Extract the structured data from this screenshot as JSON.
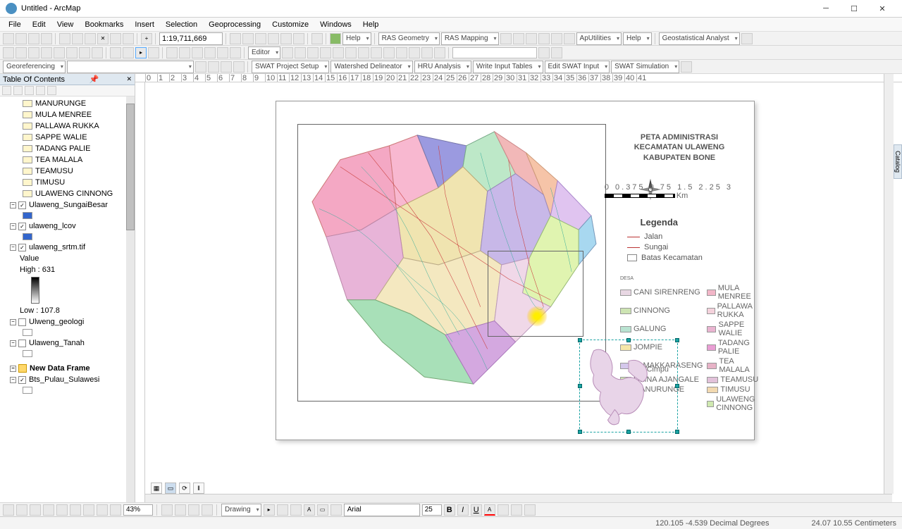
{
  "window": {
    "title": "Untitled - ArcMap"
  },
  "menu": [
    "File",
    "Edit",
    "View",
    "Bookmarks",
    "Insert",
    "Selection",
    "Geoprocessing",
    "Customize",
    "Windows",
    "Help"
  ],
  "toolbar1": {
    "scale": "1:19,711,669",
    "help": "Help",
    "ras_geom": "RAS Geometry",
    "ras_mapping": "RAS Mapping",
    "aputil": "ApUtilities",
    "help2": "Help",
    "geostat": "Geostatistical Analyst"
  },
  "toolbar2": {
    "editor": "Editor",
    "swat_setup": "SWAT Project Setup",
    "wshed": "Watershed Delineator",
    "hru": "HRU Analysis",
    "write_in": "Write Input Tables",
    "edit_swat": "Edit SWAT Input",
    "swat_sim": "SWAT Simulation",
    "georef": "Georeferencing"
  },
  "toc": {
    "title": "Table Of Contents",
    "layers": [
      {
        "label": "MANURUNGE",
        "type": "sym"
      },
      {
        "label": "MULA MENREE",
        "type": "sym"
      },
      {
        "label": "PALLAWA RUKKA",
        "type": "sym"
      },
      {
        "label": "SAPPE WALIE",
        "type": "sym"
      },
      {
        "label": "TADANG PALIE",
        "type": "sym"
      },
      {
        "label": "TEA MALALA",
        "type": "sym"
      },
      {
        "label": "TEAMUSU",
        "type": "sym"
      },
      {
        "label": "TIMUSU",
        "type": "sym"
      },
      {
        "label": "ULAWENG CINNONG",
        "type": "sym"
      }
    ],
    "groups": [
      {
        "label": "Ulaweng_SungaiBesar",
        "checked": true
      },
      {
        "label": "ulaweng_lcov",
        "checked": true
      },
      {
        "label": "ulaweng_srtm.tif",
        "checked": true,
        "value_label": "Value",
        "high": "High : 631",
        "low": "Low : 107.8",
        "gradient": true
      },
      {
        "label": "Ulweng_geologi",
        "checked": false
      },
      {
        "label": "Ulaweng_Tanah",
        "checked": false
      }
    ],
    "newframe": "New Data Frame",
    "inset_layer": "Bts_Pulau_Sulawesi"
  },
  "layout": {
    "title_l1": "PETA ADMINISTRASI",
    "title_l2": "KECAMATAN ULAWENG",
    "title_l3": "KABUPATEN BONE",
    "scale_ticks": "0 0.375 0.75  1.5  2.25  3",
    "scale_unit": "Km",
    "legend_title": "Legenda",
    "legend_lines": [
      {
        "label": "Jalan"
      },
      {
        "label": "Sungai"
      },
      {
        "label": "Batas Kecamatan",
        "box": true
      }
    ],
    "desa_hdr": "DESA",
    "desa": [
      {
        "c": "#e8d7e3",
        "l": "CANI SIRENRENG"
      },
      {
        "c": "#f2b6c8",
        "l": "MULA MENREE"
      },
      {
        "c": "#cde4b3",
        "l": "CINNONG"
      },
      {
        "c": "#f4d2dc",
        "l": "PALLAWA RUKKA"
      },
      {
        "c": "#b9e3d1",
        "l": "GALUNG"
      },
      {
        "c": "#eab4d1",
        "l": "SAPPE WALIE"
      },
      {
        "c": "#f5e6a8",
        "l": "JOMPIE"
      },
      {
        "c": "#e99ed4",
        "l": "TADANG PALIE"
      },
      {
        "c": "#d4c7ec",
        "l": "LAMAKKARASENG"
      },
      {
        "c": "#e7b3c7",
        "l": "TEA MALALA"
      },
      {
        "c": "#d1e8b3",
        "l": "LILINA AJANGALE"
      },
      {
        "c": "#e2c2da",
        "l": "TEAMUSU"
      },
      {
        "c": "#f4efb3",
        "l": "MANURUNGE"
      },
      {
        "c": "#f2d9b0",
        "l": "TIMUSU"
      },
      {
        "c": "",
        "l": ""
      },
      {
        "c": "#cfe9b0",
        "l": "ULAWENG CINNONG"
      }
    ]
  },
  "ruler_ticks": [
    "0",
    "1",
    "2",
    "3",
    "4",
    "5",
    "6",
    "7",
    "8",
    "9",
    "10",
    "11",
    "12",
    "13",
    "14",
    "15",
    "16",
    "17",
    "18",
    "19",
    "20",
    "21",
    "22",
    "23",
    "24",
    "25",
    "26",
    "27",
    "28",
    "29",
    "30",
    "31",
    "32",
    "33",
    "34",
    "35",
    "36",
    "37",
    "38",
    "39",
    "40",
    "41"
  ],
  "drawing": {
    "label": "Drawing",
    "font": "Arial",
    "size": "25",
    "zoom": "43%"
  },
  "status": {
    "coords": "120.105  -4.539 Decimal Degrees",
    "page": "24.07  10.55 Centimeters"
  },
  "catalog": "Catalog"
}
